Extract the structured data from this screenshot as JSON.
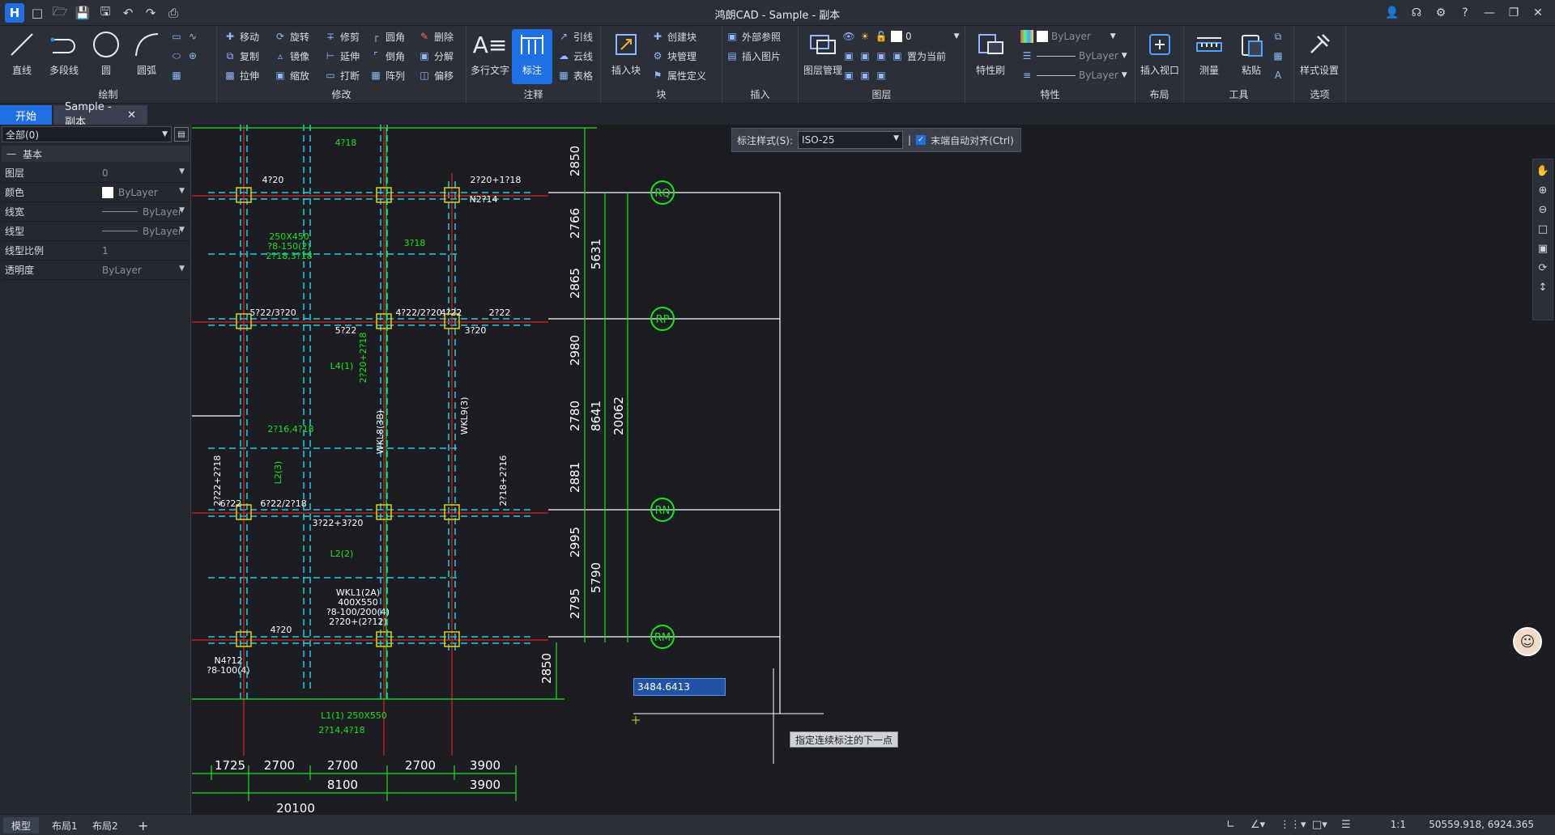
{
  "app": {
    "title": "鸿朗CAD - Sample - 副本"
  },
  "ribbon": {
    "draw": {
      "label": "绘制",
      "line": "直线",
      "polyline": "多段线",
      "circle": "圆",
      "arc": "圆弧"
    },
    "modify": {
      "label": "修改",
      "move": "移动",
      "rotate": "旋转",
      "trim": "修剪",
      "fillet": "圆角",
      "erase": "删除",
      "copy": "复制",
      "mirror": "镜像",
      "extend": "延伸",
      "chamfer": "倒角",
      "explode": "分解",
      "stretch": "拉伸",
      "scale": "缩放",
      "break": "打断",
      "array": "阵列",
      "offset": "偏移"
    },
    "annot": {
      "label": "注释",
      "mtext": "多行文字",
      "dim": "标注",
      "leader": "引线",
      "cloud": "云线",
      "table": "表格"
    },
    "block": {
      "label": "块",
      "insert": "插入块",
      "create": "创建块",
      "manage": "块管理",
      "attdef": "属性定义"
    },
    "insert": {
      "label": "插入",
      "xref": "外部参照",
      "image": "插入图片"
    },
    "layer": {
      "label": "图层",
      "manager": "图层管理",
      "current": "置为当前",
      "layername": "0"
    },
    "props": {
      "label": "特性",
      "brush": "特性刷",
      "bylayer1": "ByLayer",
      "bylayer2": "ByLayer",
      "bylayer3": "ByLayer"
    },
    "layout": {
      "label": "布局",
      "viewport": "插入视口"
    },
    "tools": {
      "label": "工具",
      "measure": "测量",
      "paste": "粘贴"
    },
    "options": {
      "label": "选项",
      "style": "样式设置"
    }
  },
  "tabs": {
    "start": "开始",
    "doc": "Sample - 副本"
  },
  "panel": {
    "select": "全部(0)",
    "section": "基本",
    "rows": [
      {
        "k": "图层",
        "v": "0"
      },
      {
        "k": "颜色",
        "v": "ByLayer"
      },
      {
        "k": "线宽",
        "v": "ByLayer"
      },
      {
        "k": "线型",
        "v": "ByLayer"
      },
      {
        "k": "线型比例",
        "v": "1"
      },
      {
        "k": "透明度",
        "v": "ByLayer"
      }
    ]
  },
  "dimbar": {
    "label": "标注样式(S):",
    "style": "ISO-25",
    "sep": "|",
    "check": "末端自动对齐(Ctrl)"
  },
  "cmd": {
    "input": "3484.6413",
    "tooltip": "指定连续标注的下一点"
  },
  "status": {
    "model": "模型",
    "layout1": "布局1",
    "layout2": "布局2",
    "scale": "1:1",
    "coords": "50559.918, 6924.365"
  },
  "drawing": {
    "axes": [
      "RQ",
      "RP",
      "RN",
      "RM"
    ],
    "dim_v1": [
      "2850",
      "2766",
      "2865",
      "2980",
      "2780",
      "2881",
      "2995",
      "2795"
    ],
    "dim_v2": [
      "5631",
      "8641",
      "5790"
    ],
    "dim_v3": "20062",
    "dim_v4": "2850",
    "dim_h1": [
      "1725",
      "2700",
      "2700",
      "2700",
      "3900"
    ],
    "dim_h2": [
      "8100",
      "3900"
    ],
    "dim_h3": "20100",
    "labels": [
      "4?18",
      "4?20",
      "2?20+1?18",
      "N2?14",
      "3?18",
      "4?22/2?20",
      "5?22/3?20",
      "5?22",
      "4?22",
      "2?22",
      "3?20",
      "L4(1)",
      "L2(2)",
      "L1(1) 250X550",
      "WKL1(2A)",
      "400X550",
      "?8-100/200(4)",
      "2?20+(2?12)",
      "6?22",
      "6?22/2?18",
      "3?22+3?20",
      "4?20",
      "N4?12",
      "?8-100(4)",
      "2?22+2?18",
      "2?18+2?16",
      "250X450",
      "?8-150(2)",
      "2?18,3?18",
      "2?16,4?18",
      "2?14,4?18",
      "L2(3)",
      "WKL8(3B)",
      "WKL9(3)",
      "2?20+2?18"
    ]
  },
  "colors": {
    "accent": "#1f6fe5",
    "green": "#17e41a",
    "cyan": "#1ad0e0",
    "yellow": "#e8d200",
    "red": "#e02020",
    "white": "#ffffff"
  }
}
